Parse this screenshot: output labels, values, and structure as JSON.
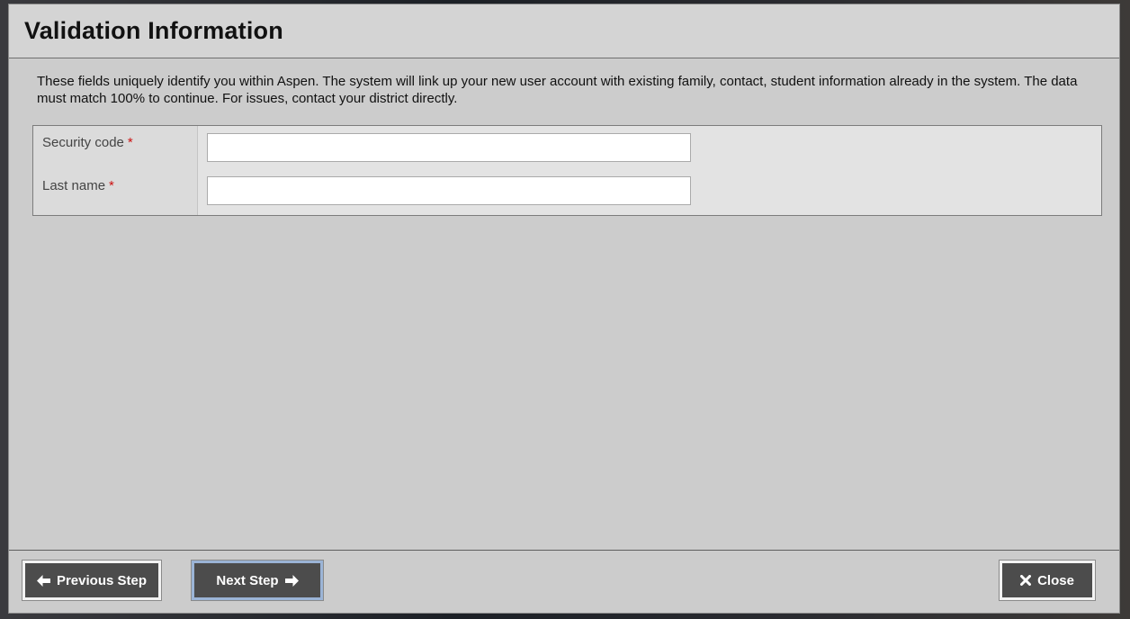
{
  "dialog": {
    "title": "Validation Information",
    "description": "These fields uniquely identify you within Aspen. The system will link up your new user account with existing family, contact, student information already in the system. The data must match 100% to continue. For issues, contact your district directly."
  },
  "form": {
    "fields": [
      {
        "label": "Security code",
        "required_marker": "*",
        "value": "",
        "placeholder": ""
      },
      {
        "label": "Last name",
        "required_marker": "*",
        "value": "",
        "placeholder": ""
      }
    ]
  },
  "footer": {
    "previous_label": "Previous Step",
    "previous_icon": "arrow-left-icon",
    "next_label": "Next Step",
    "next_icon": "arrow-right-icon",
    "close_label": "Close",
    "close_icon": "close-x-icon"
  },
  "colors": {
    "dialog_bg": "#cccccc",
    "button_bg": "#4c4c4c",
    "required": "#cc1111"
  }
}
